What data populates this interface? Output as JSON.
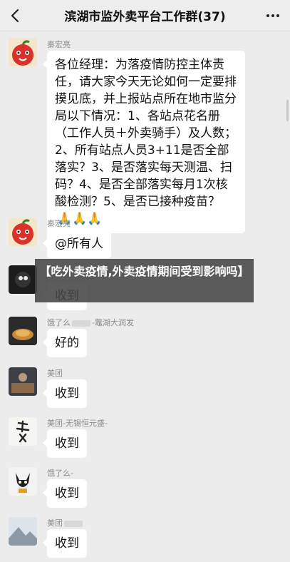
{
  "header": {
    "title": "滨湖市监外卖平台工作群(37)"
  },
  "messages": [
    {
      "sender": "秦宏亮",
      "text": "各位经理：为落疫情防控主体责任，请大家今天无论如何一定要排摸见底，并上报站点所在地市监分局以下情况：1、各站点花名册（工作人员＋外卖骑手）及人数；2、所有站点人员3+11是否全部落实？3、是否落实每天测温、扫码？4、是否全部落实每月1次核酸检测？5、是否已接种疫苗？",
      "emoji": "🙏🙏🙏"
    },
    {
      "sender": "秦宏亮",
      "text": "@所有人"
    },
    {
      "sender": "",
      "text": "收到"
    },
    {
      "sender_prefix": "饿了么",
      "sender_suffix": "-鼈湖大润发",
      "text": "好的"
    },
    {
      "sender": "美团",
      "text": "收到"
    },
    {
      "sender": "美团-无锡恒元盛-",
      "text": "收到"
    },
    {
      "sender": "饿了么-",
      "text": "收到"
    },
    {
      "sender": "美团",
      "text": "收到"
    }
  ],
  "overlay": {
    "caption": "【吃外卖疫情,外卖疫情期间受到影响吗】"
  },
  "colors": {
    "background": "#ececec",
    "bubble": "#ffffff",
    "overlay": "#464646"
  }
}
